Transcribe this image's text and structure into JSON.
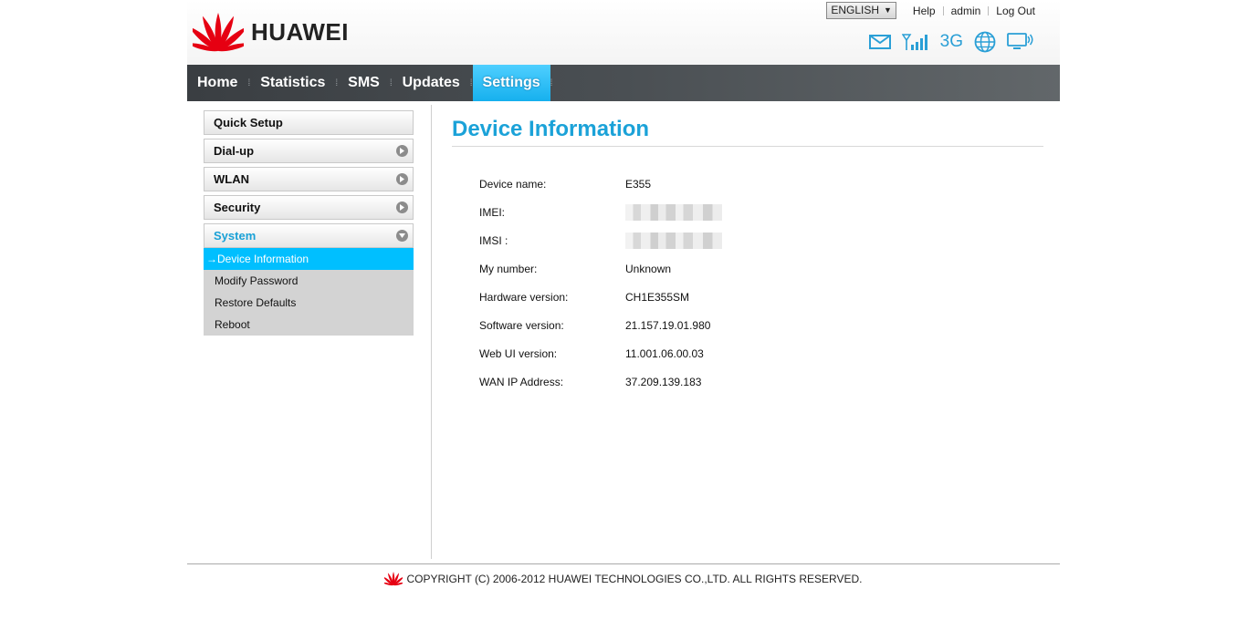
{
  "brand": {
    "name": "HUAWEI",
    "logo_icon": "huawei-petal-logo-icon",
    "logo_color": "#e60012"
  },
  "toplinks": {
    "language": "ENGLISH",
    "help": "Help",
    "user": "admin",
    "logout": "Log Out"
  },
  "status": {
    "network_type": "3G",
    "icons": [
      "mail-icon",
      "signal-strength-icon",
      "globe-icon",
      "monitor-connection-icon"
    ]
  },
  "nav": {
    "items": [
      {
        "label": "Home",
        "active": false
      },
      {
        "label": "Statistics",
        "active": false
      },
      {
        "label": "SMS",
        "active": false
      },
      {
        "label": "Updates",
        "active": false
      },
      {
        "label": "Settings",
        "active": true
      }
    ]
  },
  "sidebar": {
    "sections": [
      {
        "label": "Quick Setup",
        "expandable": false
      },
      {
        "label": "Dial-up",
        "expandable": true
      },
      {
        "label": "WLAN",
        "expandable": true
      },
      {
        "label": "Security",
        "expandable": true
      },
      {
        "label": "System",
        "expandable": true,
        "open": true
      }
    ],
    "system_items": [
      {
        "label": "→Device Information",
        "active": true
      },
      {
        "label": "Modify Password",
        "active": false
      },
      {
        "label": "Restore Defaults",
        "active": false
      },
      {
        "label": "Reboot",
        "active": false
      }
    ]
  },
  "main": {
    "title": "Device Information",
    "fields": [
      {
        "label": "Device name:",
        "value": "E355"
      },
      {
        "label": "IMEI:",
        "value": "",
        "redacted": true
      },
      {
        "label": "IMSI :",
        "value": "",
        "redacted": true
      },
      {
        "label": "My number:",
        "value": "Unknown"
      },
      {
        "label": "Hardware version:",
        "value": "CH1E355SM"
      },
      {
        "label": "Software version:",
        "value": "21.157.19.01.980"
      },
      {
        "label": "Web UI version:",
        "value": "11.001.06.00.03"
      },
      {
        "label": "WAN IP Address:",
        "value": "37.209.139.183"
      }
    ]
  },
  "footer": {
    "copyright": "COPYRIGHT (C) 2006-2012 HUAWEI TECHNOLOGIES CO.,LTD. ALL RIGHTS RESERVED."
  },
  "colors": {
    "accent": "#1ba2d8",
    "active_tab": "#16b0ee",
    "active_sub": "#00bfff",
    "nav_bg": "#44484c"
  }
}
